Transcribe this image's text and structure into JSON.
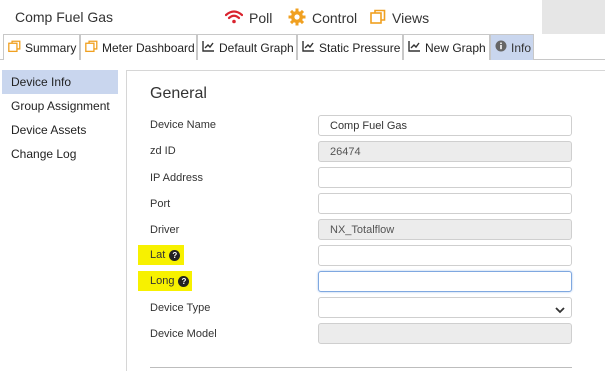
{
  "header": {
    "device_title": "Comp Fuel Gas",
    "poll_label": "Poll",
    "control_label": "Control",
    "views_label": "Views",
    "colors": {
      "poll_icon": "#d9232e",
      "control_icon": "#f0a020",
      "views_icon": "#f0a020"
    }
  },
  "tabs": [
    {
      "label": "Summary",
      "icon": "copy-icon"
    },
    {
      "label": "Meter Dashboard",
      "icon": "copy-icon"
    },
    {
      "label": "Default Graph",
      "icon": "line-chart-icon"
    },
    {
      "label": "Static Pressure",
      "icon": "line-chart-icon"
    },
    {
      "label": "New Graph",
      "icon": "line-chart-icon"
    },
    {
      "label": "Info",
      "icon": "info-icon",
      "active": true
    }
  ],
  "sidebar": {
    "items": [
      {
        "label": "Device Info",
        "active": true
      },
      {
        "label": "Group Assignment"
      },
      {
        "label": "Device Assets"
      },
      {
        "label": "Change Log"
      }
    ]
  },
  "general": {
    "title": "General",
    "fields": {
      "device_name": {
        "label": "Device Name",
        "value": "Comp Fuel Gas"
      },
      "zd_id": {
        "label": "zd ID",
        "value": "26474"
      },
      "ip_address": {
        "label": "IP Address",
        "value": ""
      },
      "port": {
        "label": "Port",
        "value": ""
      },
      "driver": {
        "label": "Driver",
        "value": "NX_Totalflow"
      },
      "lat": {
        "label": "Lat",
        "value": ""
      },
      "long": {
        "label": "Long",
        "value": ""
      },
      "device_type": {
        "label": "Device Type",
        "value": ""
      },
      "device_model": {
        "label": "Device Model",
        "value": ""
      }
    }
  },
  "colors": {
    "active_tab": "#c9d6ee",
    "highlight": "#f7f100"
  }
}
